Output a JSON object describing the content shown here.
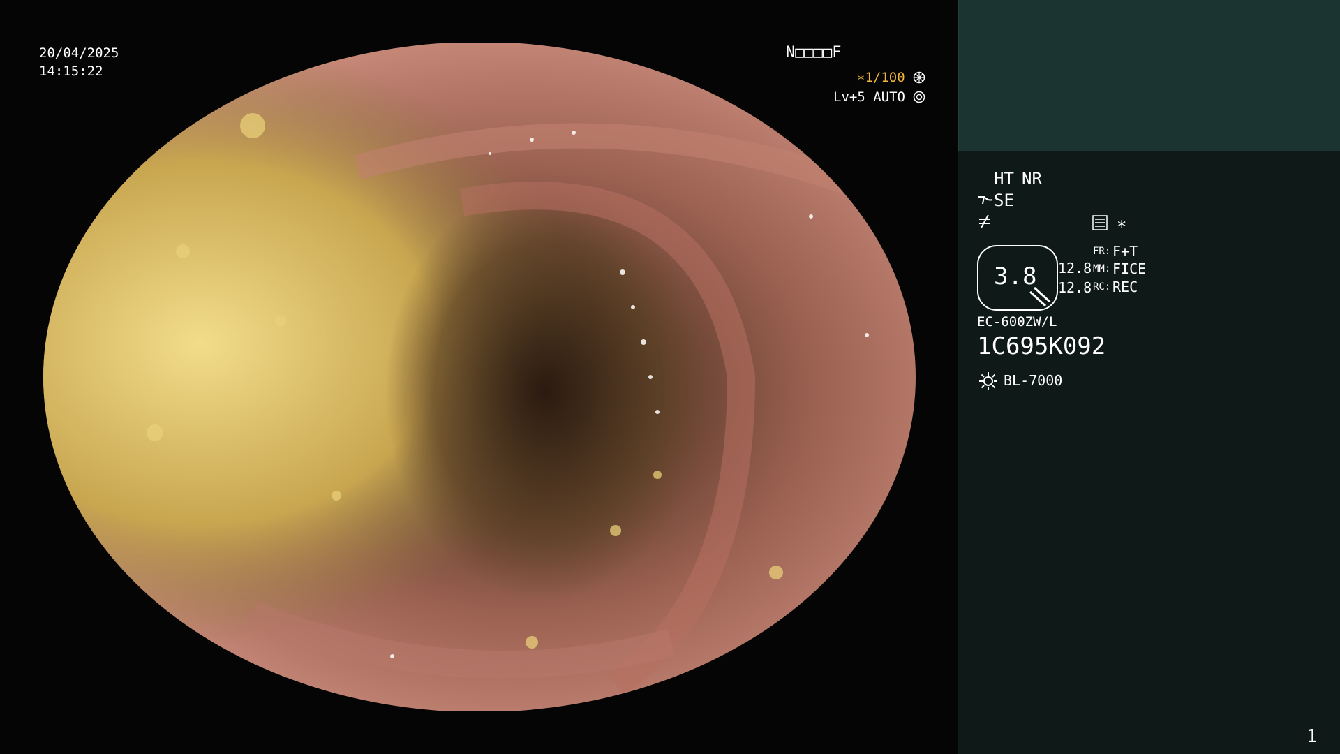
{
  "overlay": {
    "date": "20/04/2025",
    "time": "14:15:22",
    "patient_id": "N□□□□F",
    "shutter": "∗1/100",
    "shutter_icon": "aperture-icon",
    "level": "Lv+5",
    "auto_label": "AUTO",
    "auto_icon": "iris-icon"
  },
  "side_panel": {
    "ht_label": "HT",
    "nr_label": "NR",
    "se_label": "SE",
    "se_icon": "curve-icon",
    "slash_icon": "not-equal-icon",
    "menu_icon": "settings-list-icon",
    "asterisk": "∗",
    "magnification": "3.8",
    "zoom_value_1": "12.8",
    "zoom_value_2": "12.8",
    "fr_label": "FR:",
    "fr_value": "F+T",
    "mm_label": "MM:",
    "mm_value": "FICE",
    "rc_label": "RC:",
    "rc_value": "REC",
    "scope_model": "EC-600ZW/L",
    "serial": "1C695K092",
    "light_icon": "sun-icon",
    "light_source": "BL-7000",
    "page_number": "1"
  },
  "colors": {
    "accent": "#f2b73a",
    "panel_top": "#1b3431",
    "panel_bottom": "#0f1a18"
  }
}
